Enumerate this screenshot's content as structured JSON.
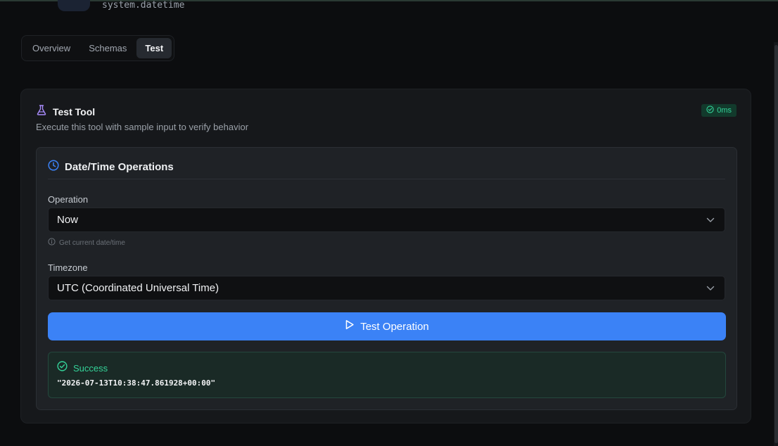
{
  "header": {
    "tool_id": "system.datetime"
  },
  "tabs": [
    {
      "label": "Overview",
      "active": false
    },
    {
      "label": "Schemas",
      "active": false
    },
    {
      "label": "Test",
      "active": true
    }
  ],
  "test_card": {
    "title": "Test Tool",
    "title_icon": "flask-icon",
    "subtitle": "Execute this tool with sample input to verify behavior",
    "duration_badge": "0ms",
    "duration_icon": "check-circle-icon"
  },
  "operation_panel": {
    "title": "Date/Time Operations",
    "title_icon": "clock-icon",
    "operation": {
      "label": "Operation",
      "value": "Now",
      "hint": "Get current date/time"
    },
    "timezone": {
      "label": "Timezone",
      "value": "UTC (Coordinated Universal Time)"
    },
    "run_button_label": "Test Operation",
    "result": {
      "status": "Success",
      "output": "\"2026-07-13T10:38:47.861928+00:00\""
    }
  },
  "colors": {
    "accent": "#3b82f6",
    "success": "#34d399",
    "flask_icon": "#a78bfa",
    "clock_icon": "#3b82f6"
  }
}
